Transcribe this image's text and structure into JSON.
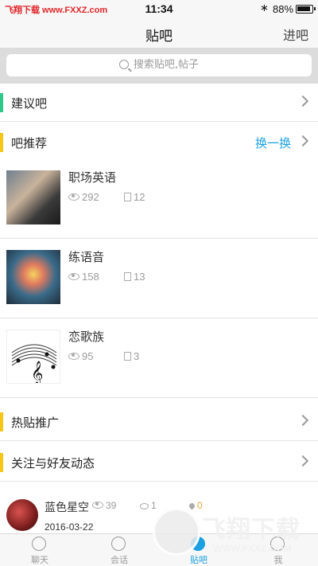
{
  "status_bar": {
    "watermark": "飞翔下载 www.FXXZ.com",
    "time": "11:34",
    "battery": "88%",
    "battery_level": 0.88
  },
  "nav": {
    "title": "贴吧",
    "right_label": "进吧"
  },
  "search": {
    "placeholder": "搜索贴吧,帖子"
  },
  "sections": {
    "suggest": {
      "label": "建议吧",
      "accent": "#2dc88a"
    },
    "recommend": {
      "label": "吧推荐",
      "refresh": "换一换",
      "accent": "#f5c518"
    },
    "hot": {
      "label": "热贴推广",
      "accent": "#f5c518"
    },
    "follow": {
      "label": "关注与好友动态",
      "accent": "#f5c518"
    }
  },
  "bars": [
    {
      "name": "职场英语",
      "views": "292",
      "posts": "12"
    },
    {
      "name": "练语音",
      "views": "158",
      "posts": "13"
    },
    {
      "name": "恋歌族",
      "views": "95",
      "posts": "3"
    }
  ],
  "feed": {
    "username": "蓝色星空",
    "views": "39",
    "comments": "1",
    "likes": "0",
    "date": "2016-03-22"
  },
  "tabs": [
    {
      "label": "聊天",
      "icon": "chat-bubble-icon"
    },
    {
      "label": "会话",
      "icon": "conversation-icon"
    },
    {
      "label": "贴吧",
      "icon": "forum-icon",
      "active": true
    },
    {
      "label": "我",
      "icon": "profile-icon"
    }
  ],
  "overlay_watermark": {
    "text": "飞翔下载",
    "url": "WWW.FXXZ.COM"
  },
  "colors": {
    "accent_blue": "#1aa0e0",
    "watermark_red": "#e0262b"
  }
}
